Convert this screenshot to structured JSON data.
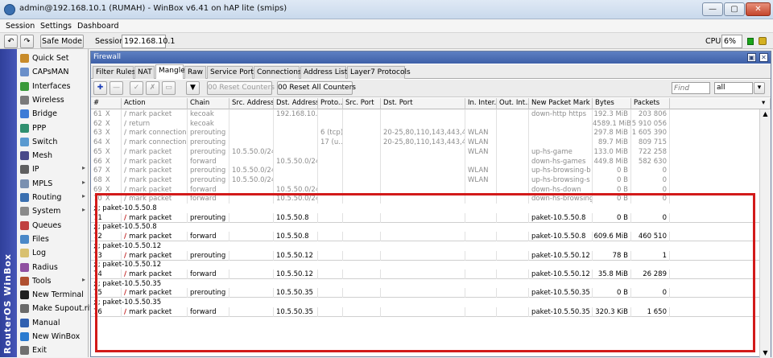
{
  "window": {
    "title": "admin@192.168.10.1 (RUMAH) - WinBox v6.41 on hAP lite (smips)",
    "minimize_glyph": "—",
    "maximize_glyph": "▢",
    "close_glyph": "✕"
  },
  "menu": [
    "Session",
    "Settings",
    "Dashboard"
  ],
  "toolbar": {
    "undo_glyph": "↶",
    "redo_glyph": "↷",
    "safe_mode": "Safe Mode",
    "session_label": "Session:",
    "session_value": "192.168.10.1",
    "cpu_label": "CPU:",
    "cpu_value": "6%"
  },
  "vstrip_text": "RouterOS WinBox",
  "sidebar": [
    {
      "label": "Quick Set",
      "icon": "quickset-icon",
      "color": "#c88b2a",
      "arrow": false
    },
    {
      "label": "CAPsMAN",
      "icon": "capsman-icon",
      "color": "#6a8fc9",
      "arrow": false
    },
    {
      "label": "Interfaces",
      "icon": "interfaces-icon",
      "color": "#3a9a3a",
      "arrow": false
    },
    {
      "label": "Wireless",
      "icon": "wireless-icon",
      "color": "#7a7a7a",
      "arrow": false
    },
    {
      "label": "Bridge",
      "icon": "bridge-icon",
      "color": "#3c7bd6",
      "arrow": false
    },
    {
      "label": "PPP",
      "icon": "ppp-icon",
      "color": "#2f8f6f",
      "arrow": false
    },
    {
      "label": "Switch",
      "icon": "switch-icon",
      "color": "#5a9ad0",
      "arrow": false
    },
    {
      "label": "Mesh",
      "icon": "mesh-icon",
      "color": "#4a4a8a",
      "arrow": false
    },
    {
      "label": "IP",
      "icon": "ip-icon",
      "color": "#606060",
      "arrow": true
    },
    {
      "label": "MPLS",
      "icon": "mpls-icon",
      "color": "#7a90b0",
      "arrow": true
    },
    {
      "label": "Routing",
      "icon": "routing-icon",
      "color": "#3a6fb0",
      "arrow": true
    },
    {
      "label": "System",
      "icon": "system-icon",
      "color": "#8a8a8a",
      "arrow": true
    },
    {
      "label": "Queues",
      "icon": "queues-icon",
      "color": "#c04040",
      "arrow": false
    },
    {
      "label": "Files",
      "icon": "files-icon",
      "color": "#4a88c8",
      "arrow": false
    },
    {
      "label": "Log",
      "icon": "log-icon",
      "color": "#d8c070",
      "arrow": false
    },
    {
      "label": "Radius",
      "icon": "radius-icon",
      "color": "#9050a0",
      "arrow": false
    },
    {
      "label": "Tools",
      "icon": "tools-icon",
      "color": "#b05030",
      "arrow": true
    },
    {
      "label": "New Terminal",
      "icon": "terminal-icon",
      "color": "#202020",
      "arrow": false
    },
    {
      "label": "Make Supout.rif",
      "icon": "supout-icon",
      "color": "#6a6a6a",
      "arrow": false
    },
    {
      "label": "Manual",
      "icon": "manual-icon",
      "color": "#3060b0",
      "arrow": false
    },
    {
      "label": "New WinBox",
      "icon": "winbox-icon",
      "color": "#2a7ad0",
      "arrow": false
    },
    {
      "label": "Exit",
      "icon": "exit-icon",
      "color": "#707070",
      "arrow": false
    }
  ],
  "firewall": {
    "title": "Firewall",
    "restore_glyph": "▣",
    "close_glyph": "✕",
    "tabs": [
      "Filter Rules",
      "NAT",
      "Mangle",
      "Raw",
      "Service Ports",
      "Connections",
      "Address Lists",
      "Layer7 Protocols"
    ],
    "active_tab": "Mangle",
    "actions": {
      "add_glyph": "✚",
      "remove_glyph": "—",
      "enable_glyph": "✓",
      "disable_glyph": "✗",
      "comment_glyph": "▭",
      "filter_glyph": "▼",
      "reset_counters": "00 Reset Counters",
      "reset_all_counters": "00 Reset All Counters",
      "find_placeholder": "Find",
      "filter_value": "all",
      "dropdown_glyph": "▾"
    },
    "columns": [
      "#",
      "Action",
      "Chain",
      "Src. Address",
      "Dst. Address",
      "Proto...",
      "Src. Port",
      "Dst. Port",
      "In. Inter...",
      "Out. Int...",
      "New Packet Mark",
      "Bytes",
      "Packets"
    ],
    "rows": [
      {
        "type": "rule",
        "disabled": true,
        "num": "61",
        "flag": "X",
        "action": "mark packet",
        "chain": "kecoak",
        "src": "",
        "dst": "192.168.10...",
        "proto": "",
        "sport": "",
        "dport": "",
        "in": "",
        "out": "",
        "mark": "down-http https",
        "bytes": "192.3 MiB",
        "packets": "203 806"
      },
      {
        "type": "rule",
        "disabled": true,
        "num": "62",
        "flag": "X",
        "action": "return",
        "chain": "kecoak",
        "src": "",
        "dst": "",
        "proto": "",
        "sport": "",
        "dport": "",
        "in": "",
        "out": "",
        "mark": "",
        "bytes": "4589.1 MiB",
        "packets": "5 910 056"
      },
      {
        "type": "rule",
        "disabled": true,
        "num": "63",
        "flag": "X",
        "action": "mark connection",
        "chain": "prerouting",
        "src": "",
        "dst": "",
        "proto": "6 (tcp)",
        "sport": "",
        "dport": "20-25,80,110,143,443,4...",
        "in": "WLAN",
        "out": "",
        "mark": "",
        "bytes": "297.8 MiB",
        "packets": "1 605 390"
      },
      {
        "type": "rule",
        "disabled": true,
        "num": "64",
        "flag": "X",
        "action": "mark connection",
        "chain": "prerouting",
        "src": "",
        "dst": "",
        "proto": "17 (u...",
        "sport": "",
        "dport": "20-25,80,110,143,443,4...",
        "in": "WLAN",
        "out": "",
        "mark": "",
        "bytes": "89.7 MiB",
        "packets": "809 715"
      },
      {
        "type": "rule",
        "disabled": true,
        "num": "65",
        "flag": "X",
        "action": "mark packet",
        "chain": "prerouting",
        "src": "10.5.50.0/24",
        "dst": "",
        "proto": "",
        "sport": "",
        "dport": "",
        "in": "WLAN",
        "out": "",
        "mark": "up-hs-game",
        "bytes": "133.0 MiB",
        "packets": "722 258"
      },
      {
        "type": "rule",
        "disabled": true,
        "num": "66",
        "flag": "X",
        "action": "mark packet",
        "chain": "forward",
        "src": "",
        "dst": "10.5.50.0/24",
        "proto": "",
        "sport": "",
        "dport": "",
        "in": "",
        "out": "",
        "mark": "down-hs-games",
        "bytes": "449.8 MiB",
        "packets": "582 630"
      },
      {
        "type": "rule",
        "disabled": true,
        "num": "67",
        "flag": "X",
        "action": "mark packet",
        "chain": "prerouting",
        "src": "10.5.50.0/24",
        "dst": "",
        "proto": "",
        "sport": "",
        "dport": "",
        "in": "WLAN",
        "out": "",
        "mark": "up-hs-browsing-b",
        "bytes": "0 B",
        "packets": "0"
      },
      {
        "type": "rule",
        "disabled": true,
        "num": "68",
        "flag": "X",
        "action": "mark packet",
        "chain": "prerouting",
        "src": "10.5.50.0/24",
        "dst": "",
        "proto": "",
        "sport": "",
        "dport": "",
        "in": "WLAN",
        "out": "",
        "mark": "up-hs-browsing-s",
        "bytes": "0 B",
        "packets": "0"
      },
      {
        "type": "rule",
        "disabled": true,
        "num": "69",
        "flag": "X",
        "action": "mark packet",
        "chain": "forward",
        "src": "",
        "dst": "10.5.50.0/24",
        "proto": "",
        "sport": "",
        "dport": "",
        "in": "",
        "out": "",
        "mark": "down-hs-down",
        "bytes": "0 B",
        "packets": "0"
      },
      {
        "type": "rule",
        "disabled": true,
        "num": "70",
        "flag": "X",
        "action": "mark packet",
        "chain": "forward",
        "src": "",
        "dst": "10.5.50.0/24",
        "proto": "",
        "sport": "",
        "dport": "",
        "in": "",
        "out": "",
        "mark": "down-hs-browsing",
        "bytes": "0 B",
        "packets": "0"
      },
      {
        "type": "comment",
        "text": ";;; paket-10.5.50.8"
      },
      {
        "type": "rule",
        "disabled": false,
        "num": "71",
        "flag": "",
        "action": "mark packet",
        "chain": "prerouting",
        "src": "",
        "dst": "10.5.50.8",
        "proto": "",
        "sport": "",
        "dport": "",
        "in": "",
        "out": "",
        "mark": "paket-10.5.50.8",
        "bytes": "0 B",
        "packets": "0"
      },
      {
        "type": "comment",
        "text": ";;; paket-10.5.50.8"
      },
      {
        "type": "rule",
        "disabled": false,
        "num": "72",
        "flag": "",
        "action": "mark packet",
        "chain": "forward",
        "src": "",
        "dst": "10.5.50.8",
        "proto": "",
        "sport": "",
        "dport": "",
        "in": "",
        "out": "",
        "mark": "paket-10.5.50.8",
        "bytes": "609.6 MiB",
        "packets": "460 510"
      },
      {
        "type": "comment",
        "text": ";;; paket-10.5.50.12"
      },
      {
        "type": "rule",
        "disabled": false,
        "num": "73",
        "flag": "",
        "action": "mark packet",
        "chain": "prerouting",
        "src": "",
        "dst": "10.5.50.12",
        "proto": "",
        "sport": "",
        "dport": "",
        "in": "",
        "out": "",
        "mark": "paket-10.5.50.12",
        "bytes": "78 B",
        "packets": "1"
      },
      {
        "type": "comment",
        "text": ";;; paket-10.5.50.12"
      },
      {
        "type": "rule",
        "disabled": false,
        "num": "74",
        "flag": "",
        "action": "mark packet",
        "chain": "forward",
        "src": "",
        "dst": "10.5.50.12",
        "proto": "",
        "sport": "",
        "dport": "",
        "in": "",
        "out": "",
        "mark": "paket-10.5.50.12",
        "bytes": "35.8 MiB",
        "packets": "26 289"
      },
      {
        "type": "comment",
        "text": ";;; paket-10.5.50.35"
      },
      {
        "type": "rule",
        "disabled": false,
        "num": "75",
        "flag": "",
        "action": "mark packet",
        "chain": "prerouting",
        "src": "",
        "dst": "10.5.50.35",
        "proto": "",
        "sport": "",
        "dport": "",
        "in": "",
        "out": "",
        "mark": "paket-10.5.50.35",
        "bytes": "0 B",
        "packets": "0"
      },
      {
        "type": "comment",
        "text": ";;; paket-10.5.50.35"
      },
      {
        "type": "rule",
        "disabled": false,
        "num": "76",
        "flag": "",
        "action": "mark packet",
        "chain": "forward",
        "src": "",
        "dst": "10.5.50.35",
        "proto": "",
        "sport": "",
        "dport": "",
        "in": "",
        "out": "",
        "mark": "paket-10.5.50.35",
        "bytes": "320.3 KiB",
        "packets": "1 650"
      }
    ],
    "scroll_up_glyph": "▲",
    "scroll_down_glyph": "▼"
  },
  "colors": {
    "highlight": "#d21a1a",
    "pen_enabled": "#c02020",
    "pen_disabled": "#a0a0a0",
    "add": "#1d3fb8",
    "status_green": "#1aa51a"
  }
}
